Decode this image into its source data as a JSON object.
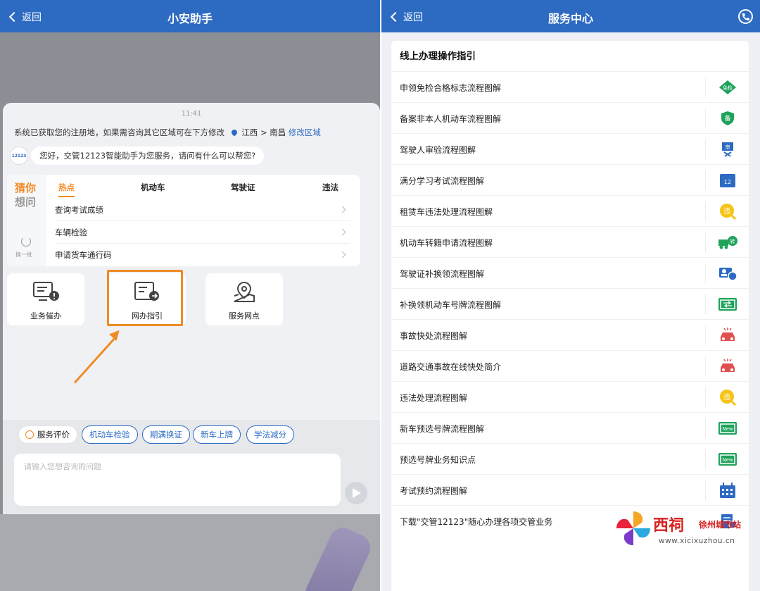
{
  "left": {
    "back_label": "返回",
    "title": "小安助手",
    "time": "11:41",
    "system_message": {
      "text": "系统已获取您的注册地，如果需咨询其它区域可在下方修改",
      "location": "江西 > 南昌",
      "link": "修改区域"
    },
    "avatar_label": "12123",
    "greeting": "您好，交管12123智能助手为您服务，请问有什么可以帮您?",
    "guess": {
      "line1": "猜你",
      "line2": "想问",
      "refresh_label": "换一批",
      "tabs": [
        "热点",
        "机动车",
        "驾驶证",
        "违法"
      ],
      "active_tab": "热点",
      "questions": [
        "查询考试成绩",
        "车辆检验",
        "申请货车通行码"
      ]
    },
    "services": [
      "业务催办",
      "网办指引",
      "服务网点"
    ],
    "highlighted_service": "网办指引",
    "chips": [
      "服务评价",
      "机动车检验",
      "期满换证",
      "新车上牌",
      "学法减分"
    ],
    "input_placeholder": "请输入您想咨询的问题"
  },
  "right": {
    "back_label": "返回",
    "title": "服务中心",
    "section_title": "线上办理操作指引",
    "items": [
      {
        "label": "申领免检合格标志流程图解",
        "icon": "exempt-badge-icon",
        "badge": "免检"
      },
      {
        "label": "备案非本人机动车流程图解",
        "icon": "record-shield-icon",
        "badge": "备"
      },
      {
        "label": "驾驶人审验流程图解",
        "icon": "audit-icon",
        "badge": "审"
      },
      {
        "label": "满分学习考试流程图解",
        "icon": "calendar-12-icon",
        "badge": "12"
      },
      {
        "label": "租赁车违法处理流程图解",
        "icon": "violation-search-icon",
        "badge": "违"
      },
      {
        "label": "机动车转籍申请流程图解",
        "icon": "transfer-truck-icon",
        "badge": "转"
      },
      {
        "label": "驾驶证补换领流程图解",
        "icon": "license-card-icon",
        "badge": ""
      },
      {
        "label": "补换领机动车号牌流程图解",
        "icon": "plate-exchange-icon",
        "badge": ""
      },
      {
        "label": "事故快处流程图解",
        "icon": "accident-car-icon",
        "badge": ""
      },
      {
        "label": "道路交通事故在线快处简介",
        "icon": "accident-car-icon",
        "badge": ""
      },
      {
        "label": "违法处理流程图解",
        "icon": "violation-search-icon",
        "badge": "违"
      },
      {
        "label": "新车预选号牌流程图解",
        "icon": "new-plate-icon",
        "badge": "New"
      },
      {
        "label": "预选号牌业务知识点",
        "icon": "new-plate-icon",
        "badge": "New"
      },
      {
        "label": "考试预约流程图解",
        "icon": "calendar-grid-icon",
        "badge": ""
      },
      {
        "label": "下载\"交管12123\"随心办理各项交管业务",
        "icon": "download-doc-icon",
        "badge": ""
      }
    ]
  },
  "watermark": {
    "brand": "西祠",
    "sub": "徐州城市站",
    "url": "www.xicixuzhou.cn"
  },
  "colors": {
    "primary": "#2d6bc3",
    "accent": "#f08a24",
    "green": "#1fa35a",
    "yellow": "#f5c417",
    "red": "#e05050"
  }
}
